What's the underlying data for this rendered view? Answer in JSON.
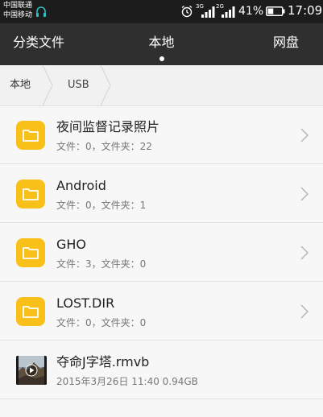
{
  "status_bar": {
    "carrier_1": "中国联通",
    "carrier_2": "中国移动",
    "network_1": "3G",
    "network_2": "2G",
    "battery_percent": "41%",
    "battery_level": 0.41,
    "time": "17:09",
    "icons": [
      "headset-icon",
      "alarm-clock-icon",
      "signal-icon",
      "battery-icon"
    ]
  },
  "tabs": {
    "categories": "分类文件",
    "local": "本地",
    "cloud": "网盘",
    "active": "local"
  },
  "breadcrumb": {
    "root": "本地",
    "current": "USB"
  },
  "files": [
    {
      "name": "夜间监督记录照片",
      "detail": "文件：0，文件夹：22",
      "type": "folder"
    },
    {
      "name": "Android",
      "detail": "文件：0，文件夹：1",
      "type": "folder"
    },
    {
      "name": "GHO",
      "detail": "文件：3，文件夹：0",
      "type": "folder"
    },
    {
      "name": "LOST.DIR",
      "detail": "文件：0，文件夹：0",
      "type": "folder"
    },
    {
      "name": "夺命J字塔.rmvb",
      "detail": "2015年3月26日 11:40 0.94GB",
      "type": "video"
    }
  ],
  "colors": {
    "status_bar_bg": "#1c1c1c",
    "tab_bar_bg": "#2f2f2f",
    "folder_yellow": "#f8c018",
    "list_bg": "#f7f7f7"
  }
}
